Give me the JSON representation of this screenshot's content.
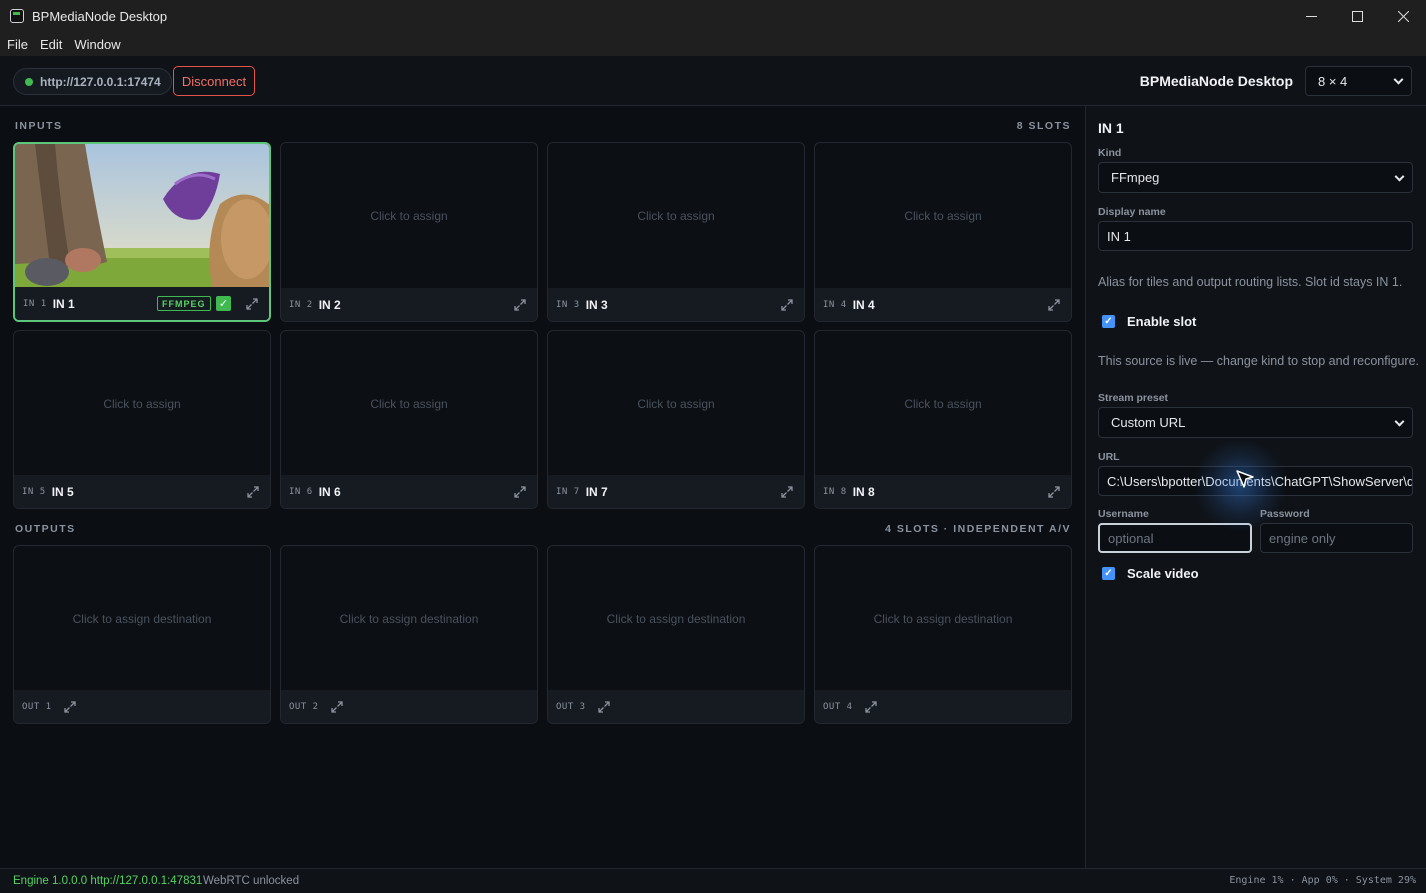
{
  "window": {
    "title": "BPMediaNode Desktop",
    "controls": {
      "minimize": "—",
      "maximize": "☐",
      "close": "✕"
    }
  },
  "menu": [
    "File",
    "Edit",
    "Window"
  ],
  "toolbar": {
    "server_url": "http://127.0.0.1:17474",
    "disconnect_label": "Disconnect",
    "app_title": "BPMediaNode Desktop",
    "layout_value": "8 × 4"
  },
  "inputs": {
    "label": "INPUTS",
    "count": "8 SLOTS",
    "empty_text": "Click to assign",
    "slots": [
      {
        "id": "IN 1",
        "name": "IN 1",
        "badge": "FFMPEG",
        "live": true
      },
      {
        "id": "IN 2",
        "name": "IN 2"
      },
      {
        "id": "IN 3",
        "name": "IN 3"
      },
      {
        "id": "IN 4",
        "name": "IN 4"
      },
      {
        "id": "IN 5",
        "name": "IN 5"
      },
      {
        "id": "IN 6",
        "name": "IN 6"
      },
      {
        "id": "IN 7",
        "name": "IN 7"
      },
      {
        "id": "IN 8",
        "name": "IN 8"
      }
    ]
  },
  "outputs": {
    "label": "OUTPUTS",
    "count": "4 SLOTS · INDEPENDENT A/V",
    "empty_text": "Click to assign destination",
    "slots": [
      {
        "id": "OUT 1"
      },
      {
        "id": "OUT 2"
      },
      {
        "id": "OUT 3"
      },
      {
        "id": "OUT 4"
      }
    ]
  },
  "side": {
    "title": "IN 1",
    "kind_label": "Kind",
    "kind_value": "FFmpeg",
    "display_name_label": "Display name",
    "display_name_value": "IN 1",
    "alias_help": "Alias for tiles and output routing lists. Slot id stays IN 1.",
    "enable_slot_label": "Enable slot",
    "enable_slot_checked": true,
    "live_help": "This source is live — change kind to stop and reconfigure.",
    "preset_label": "Stream preset",
    "preset_value": "Custom URL",
    "url_label": "URL",
    "url_value": "C:\\Users\\bpotter\\Documents\\ChatGPT\\ShowServer\\docu",
    "username_label": "Username",
    "username_placeholder": "optional",
    "password_label": "Password",
    "password_placeholder": "engine only",
    "scale_video_label": "Scale video",
    "scale_video_checked": true
  },
  "status": {
    "engine": "Engine 1.0.0.0 http://127.0.0.1:47831",
    "webrtc": "WebRTC unlocked",
    "metrics": "Engine 1% · App 0% · System 29%"
  },
  "colors": {
    "accent_green": "#3fb950",
    "danger": "#e5534b",
    "checkbox_blue": "#4493f8",
    "background": "#0b0e13"
  }
}
